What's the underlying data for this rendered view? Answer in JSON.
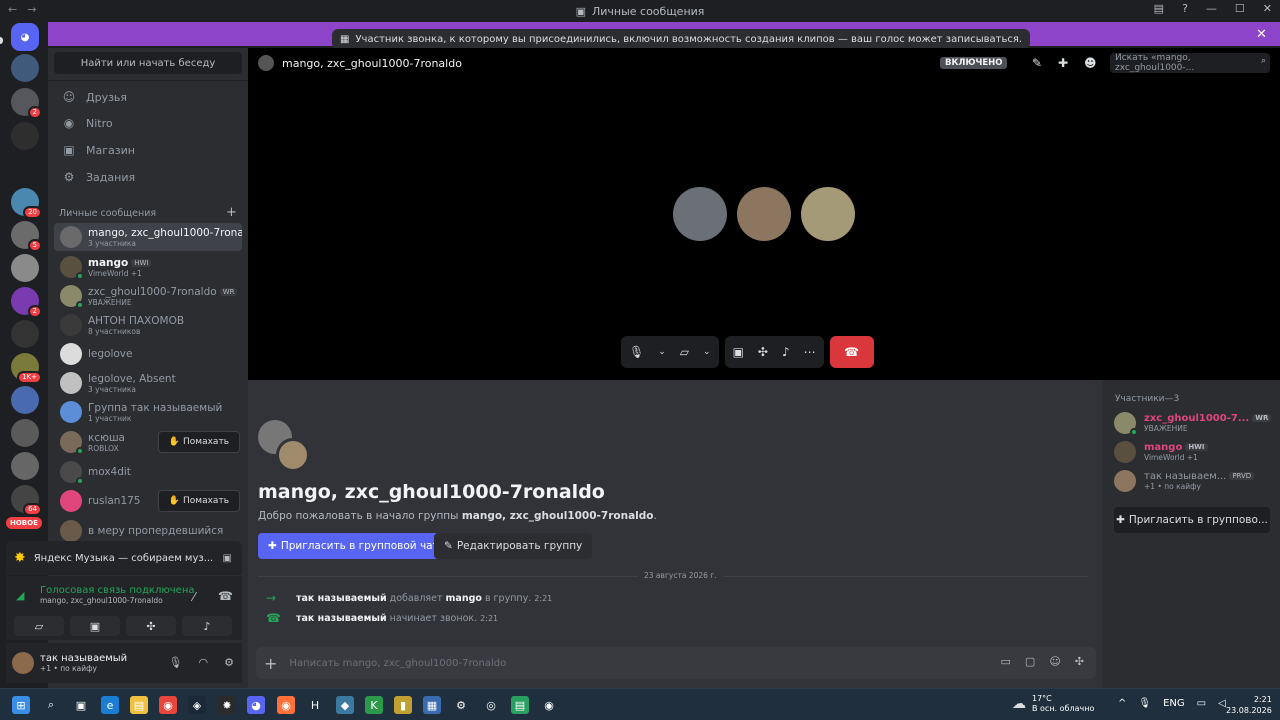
{
  "window": {
    "title": "Личные сообщения"
  },
  "banner": {
    "notice": "Участник звонка, к которому вы присоединились, включил возможность создания клипов — ваш голос может записываться."
  },
  "rail": {
    "badges": [
      "2",
      "20",
      "5",
      "1K+",
      "2",
      "64"
    ],
    "new_label": "НОВОЕ"
  },
  "sidebar": {
    "find_button": "Найти или начать беседу",
    "nav": [
      {
        "label": "Друзья",
        "icon": "friends-icon"
      },
      {
        "label": "Nitro",
        "icon": "nitro-icon"
      },
      {
        "label": "Магазин",
        "icon": "shop-icon"
      },
      {
        "label": "Задания",
        "icon": "quests-icon"
      }
    ],
    "dm_header": "Личные сообщения",
    "dms": [
      {
        "name": "mango, zxc_ghoul1000-7ronaldo",
        "sub": "3 участника"
      },
      {
        "name": "mango",
        "tag": "HWI",
        "sub": "VimeWorld +1"
      },
      {
        "name": "zxc_ghoul1000-7ronaldo",
        "tag": "WR",
        "sub": "УВАЖЕНИЕ"
      },
      {
        "name": "АНТОН ПАХОМОВ",
        "sub": "8 участников"
      },
      {
        "name": "legolove",
        "sub": ""
      },
      {
        "name": "legolove, Absent",
        "sub": "3 участника"
      },
      {
        "name": "Группа так называемый",
        "sub": "1 участник"
      },
      {
        "name": "ксюша",
        "sub": "ROBLOX",
        "wave": "Помахать"
      },
      {
        "name": "mox4dit",
        "sub": ""
      },
      {
        "name": "ruslan175",
        "sub": "",
        "wave": "Помахать"
      },
      {
        "name": "в меру пропердевшийся",
        "sub": ""
      }
    ]
  },
  "music": {
    "text": "Яндекс Музыка — собираем муз..."
  },
  "voice": {
    "status": "Голосовая связь подключена",
    "channel": "mango, zxc_ghoul1000-7ronaldo"
  },
  "user": {
    "name": "так называемый",
    "status": "+1 • по кайфу"
  },
  "header": {
    "channel": "mango, zxc_ghoul1000-7ronaldo",
    "clips_badge": "ВКЛЮЧЕНО",
    "search_placeholder": "Искать «mango, zxc_ghoul1000-..."
  },
  "group": {
    "title": "mango, zxc_ghoul1000-7ronaldo",
    "welcome_prefix": "Добро пожаловать в начало группы ",
    "welcome_name": "mango, zxc_ghoul1000-7ronaldo",
    "welcome_suffix": ".",
    "invite_button": "Пригласить в групповой чат",
    "edit_button": "Редактировать группу",
    "date": "23 августа 2026 г.",
    "messages": [
      {
        "actor": "так называемый",
        "text": " добавляет ",
        "target": "mango",
        "tail": " в группу.",
        "time": "2:21"
      },
      {
        "actor": "так называемый",
        "text": " начинает звонок.",
        "target": "",
        "tail": "",
        "time": "2:21"
      }
    ],
    "composer_placeholder": "Написать mango, zxc_ghoul1000-7ronaldo"
  },
  "members": {
    "header": "Участники—3",
    "list": [
      {
        "name": "zxc_ghoul1000-7...",
        "tag": "WR",
        "sub": "УВАЖЕНИЕ",
        "color": "#e0467c"
      },
      {
        "name": "mango",
        "tag": "HWI",
        "sub": "VimeWorld +1",
        "color": "#e0467c"
      },
      {
        "name": "так называем...",
        "tag": "PRVD",
        "sub": "+1 • по кайфу",
        "color": "#949ba4"
      }
    ],
    "invite_button": "Пригласить в группово..."
  },
  "taskbar": {
    "weather_temp": "17°C",
    "weather_desc": "В осн. облачно",
    "lang": "ENG",
    "time": "2:21",
    "date": "23.08.2026"
  },
  "colors": {
    "accent": "#5865f2",
    "danger": "#da373c",
    "online": "#23a55a",
    "banner": "#8e44c8"
  }
}
